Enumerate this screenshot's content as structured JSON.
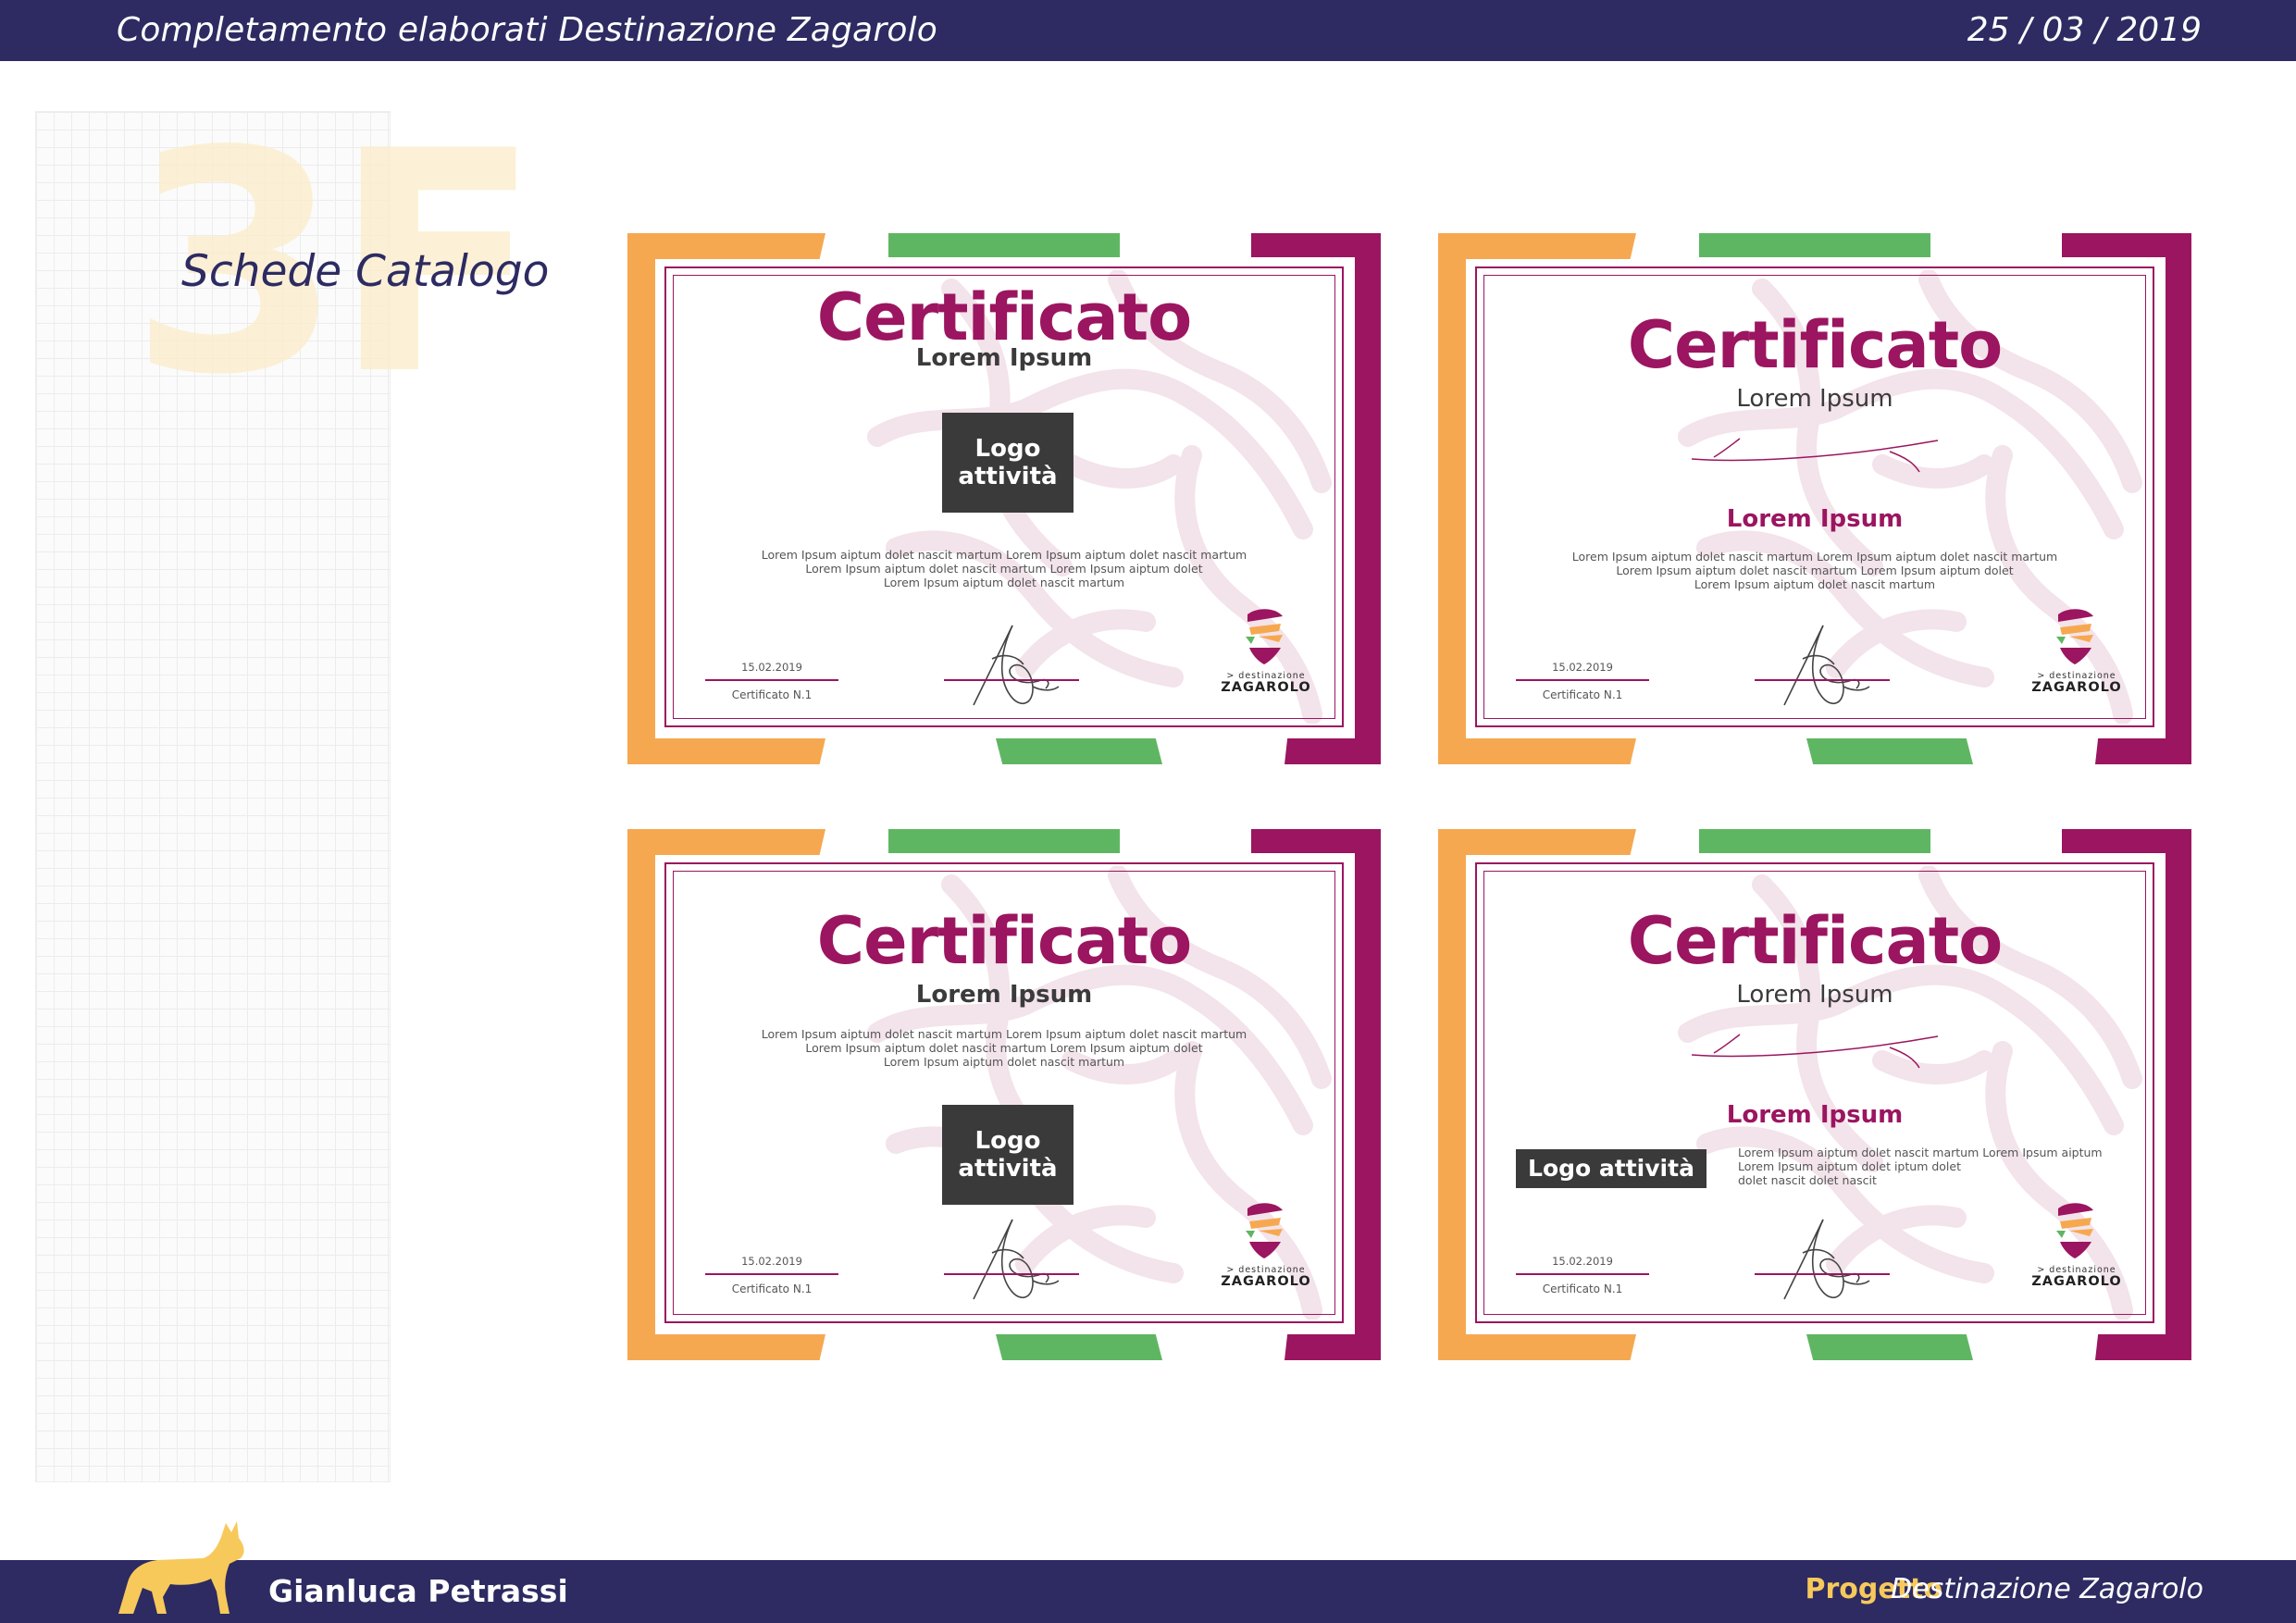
{
  "header": {
    "title": "Completamento elaborati Destinazione Zagarolo",
    "date": "25 / 03 / 2019"
  },
  "section": {
    "number": "3F",
    "title": "Schede Catalogo"
  },
  "footer": {
    "author": "Gianluca Petrassi",
    "project_label": "Progetto",
    "project_name": "Destinazione Zagarolo"
  },
  "colors": {
    "navy": "#2d2b62",
    "orange": "#f6a851",
    "green": "#5fb662",
    "purple": "#9b1560",
    "yellow": "#f7c95b"
  },
  "certificates": [
    {
      "title": "Certificato",
      "subtitle": "Lorem Ipsum",
      "logo_line1": "Logo",
      "logo_line2": "attività",
      "body_line1": "Lorem Ipsum aiptum dolet nascit martum Lorem Ipsum aiptum dolet nascit martum",
      "body_line2": "Lorem Ipsum aiptum dolet nascit martum Lorem Ipsum aiptum dolet",
      "body_line3": "Lorem Ipsum aiptum dolet nascit martum",
      "date": "15.02.2019",
      "number": "Certificato N.1",
      "brand_small": "> destinazione",
      "brand_big": "ZAGAROLO"
    },
    {
      "title": "Certificato",
      "subtitle": "Lorem Ipsum",
      "name": "Lorem Ipsum",
      "body_line1": "Lorem Ipsum aiptum dolet nascit martum Lorem Ipsum aiptum dolet nascit martum",
      "body_line2": "Lorem Ipsum aiptum dolet nascit martum Lorem Ipsum aiptum dolet",
      "body_line3": "Lorem Ipsum aiptum dolet nascit martum",
      "date": "15.02.2019",
      "number": "Certificato N.1",
      "brand_small": "> destinazione",
      "brand_big": "ZAGAROLO"
    },
    {
      "title": "Certificato",
      "subtitle": "Lorem Ipsum",
      "logo_line1": "Logo",
      "logo_line2": "attività",
      "body_line1": "Lorem Ipsum aiptum dolet nascit martum Lorem Ipsum aiptum dolet nascit martum",
      "body_line2": "Lorem Ipsum aiptum dolet nascit martum Lorem Ipsum aiptum dolet",
      "body_line3": "Lorem Ipsum aiptum dolet nascit martum",
      "date": "15.02.2019",
      "number": "Certificato N.1",
      "brand_small": "> destinazione",
      "brand_big": "ZAGAROLO"
    },
    {
      "title": "Certificato",
      "subtitle": "Lorem Ipsum",
      "name": "Lorem Ipsum",
      "logo_inline": "Logo attività",
      "body_line1": "Lorem Ipsum aiptum dolet nascit martum Lorem Ipsum aiptum",
      "body_line2": "Lorem Ipsum aiptum dolet iptum dolet",
      "body_line3": "dolet nascit dolet nascit",
      "date": "15.02.2019",
      "number": "Certificato N.1",
      "brand_small": "> destinazione",
      "brand_big": "ZAGAROLO"
    }
  ]
}
